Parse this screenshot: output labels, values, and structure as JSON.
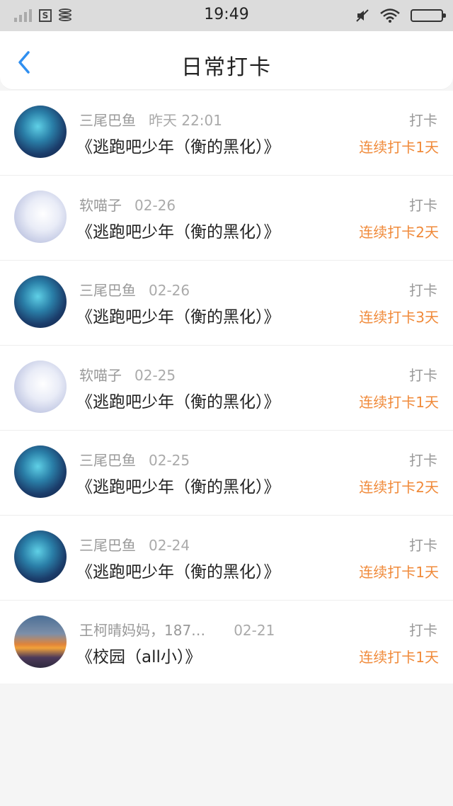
{
  "status_bar": {
    "time": "19:49",
    "sim_icon": "S"
  },
  "header": {
    "title": "日常打卡"
  },
  "entries": [
    {
      "user": "三尾巴鱼",
      "date": "昨天 22:01",
      "book": "《逃跑吧少年（衡的黑化）》",
      "label": "打卡",
      "streak": "连续打卡1天"
    },
    {
      "user": "软喵子",
      "date": "02-26",
      "book": "《逃跑吧少年（衡的黑化）》",
      "label": "打卡",
      "streak": "连续打卡2天"
    },
    {
      "user": "三尾巴鱼",
      "date": "02-26",
      "book": "《逃跑吧少年（衡的黑化）》",
      "label": "打卡",
      "streak": "连续打卡3天"
    },
    {
      "user": "软喵子",
      "date": "02-25",
      "book": "《逃跑吧少年（衡的黑化）》",
      "label": "打卡",
      "streak": "连续打卡1天"
    },
    {
      "user": "三尾巴鱼",
      "date": "02-25",
      "book": "《逃跑吧少年（衡的黑化）》",
      "label": "打卡",
      "streak": "连续打卡2天"
    },
    {
      "user": "三尾巴鱼",
      "date": "02-24",
      "book": "《逃跑吧少年（衡的黑化）》",
      "label": "打卡",
      "streak": "连续打卡1天"
    },
    {
      "user": "王柯晴妈妈，187…",
      "date": "02-21",
      "book": "《校园（all小）》",
      "label": "打卡",
      "streak": "连续打卡1天"
    }
  ],
  "colors": {
    "accent_blue": "#2f8ff0",
    "streak_orange": "#f08a3a"
  }
}
